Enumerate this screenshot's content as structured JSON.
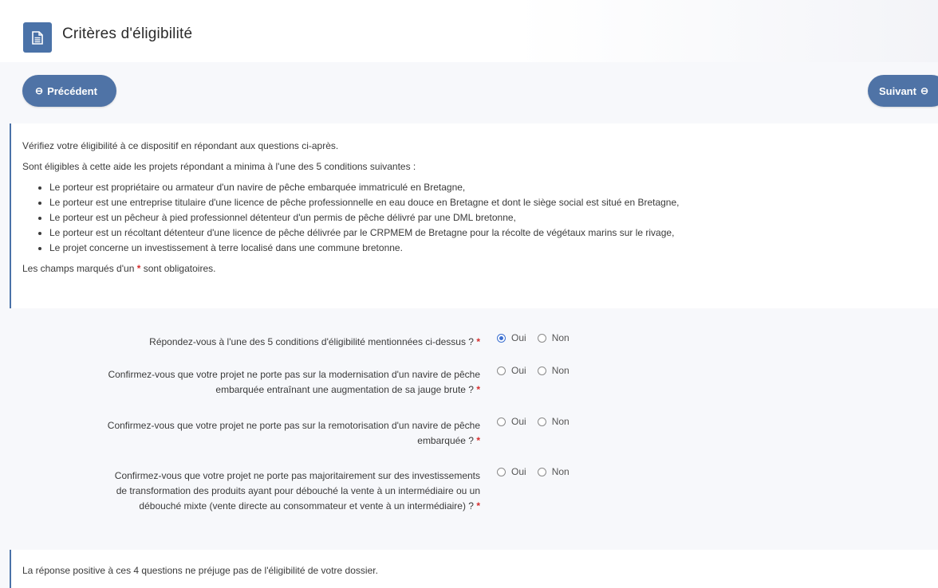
{
  "header": {
    "title": "Critères d'éligibilité",
    "icon": "document-icon"
  },
  "nav": {
    "prev_label": "Précédent",
    "next_label": "Suivant"
  },
  "info": {
    "intro": "Vérifiez votre éligibilité à ce dispositif en répondant aux questions ci-après.",
    "conditions_intro": "Sont éligibles à cette aide les projets répondant a minima à l'une des 5 conditions suivantes :",
    "conditions": [
      "Le porteur est propriétaire ou armateur d'un navire de pêche embarquée immatriculé en Bretagne,",
      "Le porteur est une entreprise titulaire d'une licence de pêche professionnelle en eau douce en Bretagne et dont le siège social est situé en Bretagne,",
      "Le porteur est un pêcheur à pied professionnel détenteur d'un permis de pêche délivré par une DML bretonne,",
      "Le porteur est un récoltant détenteur d'une licence de pêche délivrée par le CRPMEM de Bretagne pour la récolte de végétaux marins sur le rivage,",
      "Le projet concerne un investissement à terre localisé dans une commune bretonne."
    ],
    "required_prefix": "Les champs marqués d'un",
    "required_star": "*",
    "required_suffix": "sont obligatoires."
  },
  "questions": [
    {
      "label_lines": [
        "Répondez-vous à l'une des 5 conditions d'éligibilité mentionnées ci-dessus ?"
      ],
      "yes": "Oui",
      "no": "Non",
      "selected": "Oui"
    },
    {
      "label_lines": [
        "Confirmez-vous que votre projet ne porte pas sur la modernisation d'un navire de pêche",
        "embarquée entraînant une augmentation de sa jauge brute ?"
      ],
      "yes": "Oui",
      "no": "Non",
      "selected": ""
    },
    {
      "label_lines": [
        "Confirmez-vous que votre projet ne porte pas sur la remotorisation d'un navire de pêche",
        "embarquée ?"
      ],
      "yes": "Oui",
      "no": "Non",
      "selected": ""
    },
    {
      "label_lines": [
        "Confirmez-vous que votre projet ne porte pas majoritairement sur des investissements",
        "de transformation des produits ayant pour débouché la vente à un intermédiaire ou un",
        "débouché mixte (vente directe au consommateur et vente à un intermédiaire) ?"
      ],
      "yes": "Oui",
      "no": "Non",
      "selected": ""
    }
  ],
  "footer": {
    "note": "La réponse positive à ces 4 questions ne préjuge pas de l'éligibilité de votre dossier."
  },
  "colors": {
    "accent": "#4f73a6",
    "required": "#d62d2d",
    "radio_selected": "#3b6fd0"
  }
}
